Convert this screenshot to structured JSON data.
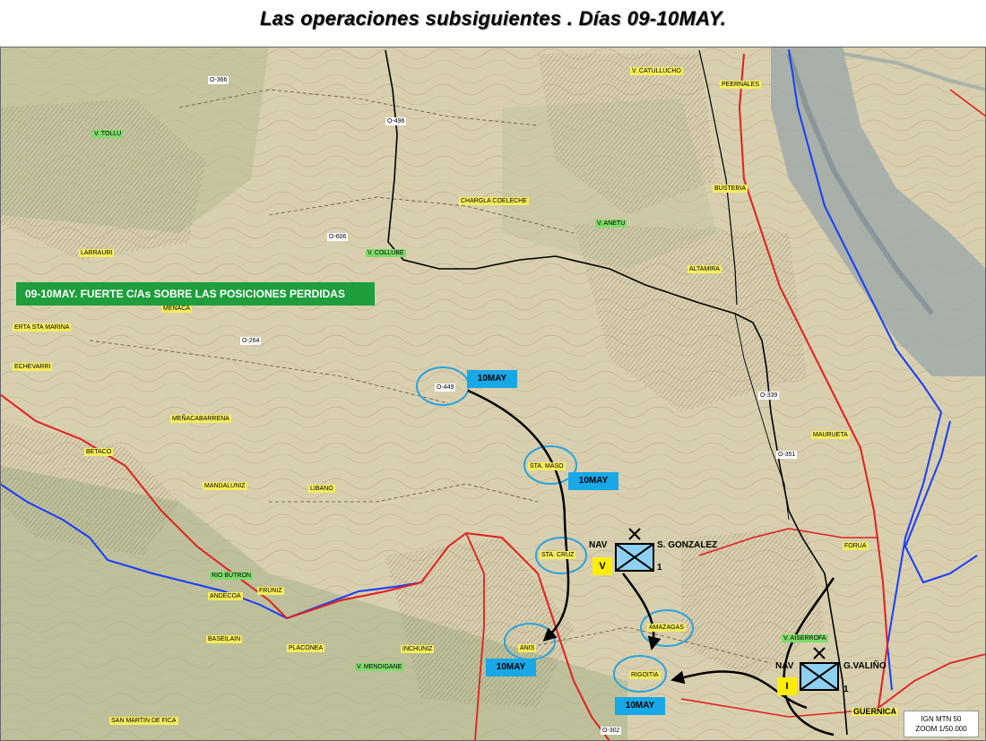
{
  "title": "Las operaciones subsiguientes . Días 09-10MAY.",
  "banner": "09-10MAY. FUERTE C/As SOBRE LAS POSICIONES PERDIDAS",
  "date_tags": [
    "10MAY",
    "10MAY",
    "10MAY",
    "10MAY"
  ],
  "units": {
    "unit1": {
      "tag": "NAV",
      "echelon": "V",
      "name": "S. GONZALEZ",
      "number": "1"
    },
    "unit2": {
      "tag": "NAV",
      "echelon": "I",
      "name": "G.VALIÑO",
      "number": "1"
    }
  },
  "scale_box": {
    "line1": "IGN MTN 50",
    "line2": "ZOOM 1/50.000"
  },
  "place_labels": {
    "tollu": "V. TOLLU",
    "catuchu": "V. CATULLUCHO",
    "peernales": "PEERNALES",
    "o366": "O-366",
    "o496": "O-496",
    "chargla": "CHARGLA COELECHE",
    "busteria": "BUSTERIA",
    "anetu": "V. ANETU",
    "o606": "O-606",
    "collube": "V. COLLUBE",
    "larrauri": "LARRAURI",
    "altamira": "ALTAMIRA",
    "menaca": "MEÑACA",
    "erta": "ERTA STA MARINA",
    "o264": "O-264",
    "echevarri": "ECHEVARRI",
    "o449": "O-449",
    "o339": "O-339",
    "mauruet": "MAURUETA",
    "menacabarrena": "MEÑACABARRENA",
    "o351": "O-351",
    "betaco": "BETACO",
    "sta_maso": "STA. MASO",
    "mandaluniz": "MANDALUNIZ",
    "libano": "LIBANO",
    "sta_cruz": "STA. CRUZ",
    "foruaa": "FORUA",
    "rio_butron": "RIO BUTRON",
    "andecoa": "ANDECOA",
    "fruniz": "FRUNIZ",
    "amazagas": "AMAZAGAS",
    "aiserrofa": "V. AISERROFA",
    "baseilain": "BASEILAIN",
    "placonea": "PLACONEA",
    "anis": "ANIS",
    "inchuniz": "INCHUNIZ",
    "mendigane": "V. MENDIGANE",
    "rigoitia": "RIGOITIA",
    "guernica": "GUERNICA",
    "san_martin": "SAN MARTIN DE FICA",
    "o302": "O-302"
  }
}
